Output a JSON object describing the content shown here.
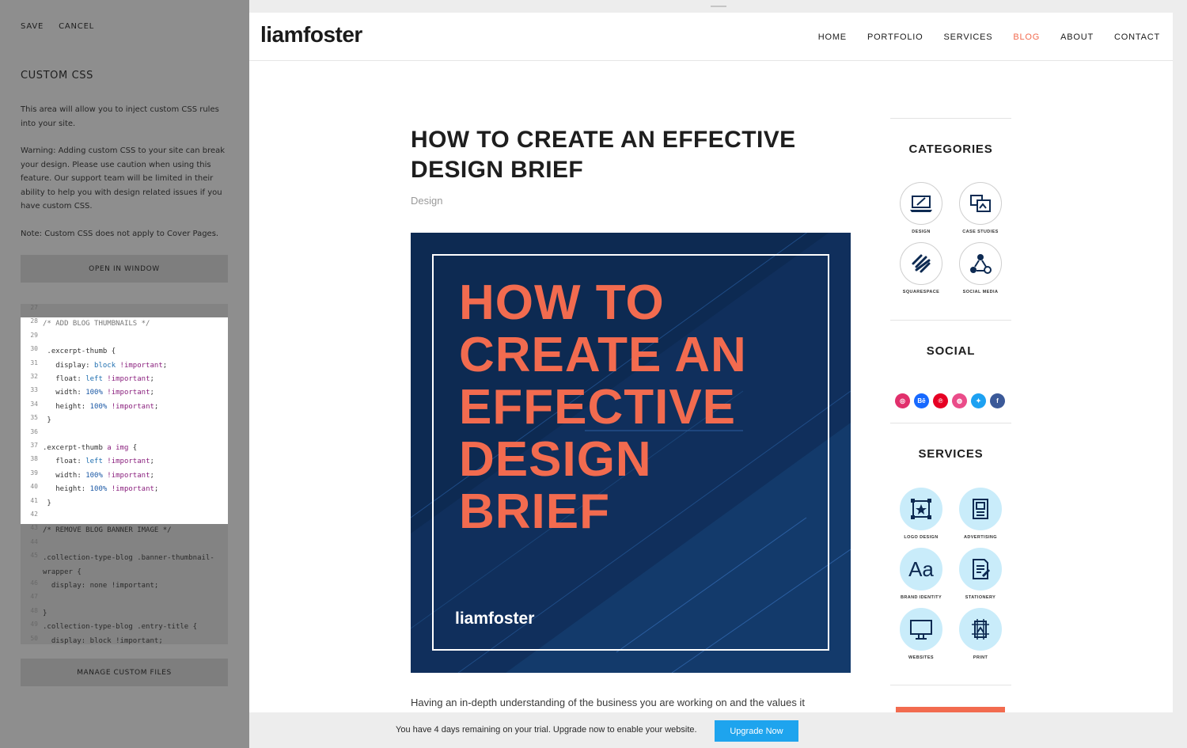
{
  "editor": {
    "save_label": "SAVE",
    "cancel_label": "CANCEL",
    "title": "CUSTOM CSS",
    "intro": "This area will allow you to inject custom CSS rules into your site.",
    "warning": "Warning: Adding custom CSS to your site can break your design. Please use caution when using this feature. Our support team will be limited in their ability to help you with design related issues if you have custom CSS.",
    "note": "Note: Custom CSS does not apply to Cover Pages.",
    "open_window_label": "OPEN IN WINDOW",
    "manage_files_label": "MANAGE CUSTOM FILES",
    "code_lines": [
      {
        "n": "27",
        "text": ""
      },
      {
        "n": "28",
        "text": "/* ADD BLOG THUMBNAILS */"
      },
      {
        "n": "29",
        "text": ""
      },
      {
        "n": "30",
        "text": " .excerpt-thumb {"
      },
      {
        "n": "31",
        "text": "   display: block !important;"
      },
      {
        "n": "32",
        "text": "   float: left !important;"
      },
      {
        "n": "33",
        "text": "   width: 100% !important;"
      },
      {
        "n": "34",
        "text": "   height: 100% !important;"
      },
      {
        "n": "35",
        "text": " }"
      },
      {
        "n": "36",
        "text": ""
      },
      {
        "n": "37",
        "text": ".excerpt-thumb a img {"
      },
      {
        "n": "38",
        "text": "   float: left !important;"
      },
      {
        "n": "39",
        "text": "   width: 100% !important;"
      },
      {
        "n": "40",
        "text": "   height: 100% !important;"
      },
      {
        "n": "41",
        "text": " }"
      },
      {
        "n": "42",
        "text": ""
      },
      {
        "n": "43",
        "text": "/* REMOVE BLOG BANNER IMAGE */"
      },
      {
        "n": "44",
        "text": ""
      },
      {
        "n": "45",
        "text": ".collection-type-blog .banner-thumbnail-"
      },
      {
        "n": "",
        "text": "wrapper {"
      },
      {
        "n": "46",
        "text": "  display: none !important;"
      },
      {
        "n": "47",
        "text": ""
      },
      {
        "n": "48",
        "text": "}"
      },
      {
        "n": "49",
        "text": ".collection-type-blog .entry-title {"
      },
      {
        "n": "50",
        "text": "  display: block !important;"
      }
    ]
  },
  "site": {
    "logo": "liamfoster",
    "nav": [
      "HOME",
      "PORTFOLIO",
      "SERVICES",
      "BLOG",
      "ABOUT",
      "CONTACT"
    ],
    "active_nav": "BLOG",
    "accent_color": "#f26b4f"
  },
  "post": {
    "title": "HOW TO CREATE AN EFFECTIVE DESIGN BRIEF",
    "category": "Design",
    "hero_lines": [
      "HOW TO",
      "CREATE AN",
      "EFFECTIVE",
      "DESIGN",
      "BRIEF"
    ],
    "hero_brand": "liamfoster",
    "excerpt": "Having an in-depth understanding of the business you are working on and the values it"
  },
  "sidebar": {
    "categories_heading": "CATEGORIES",
    "categories": [
      {
        "label": "DESIGN",
        "icon": "laptop-design-icon"
      },
      {
        "label": "CASE STUDIES",
        "icon": "case-studies-icon"
      },
      {
        "label": "SQUARESPACE",
        "icon": "squarespace-icon"
      },
      {
        "label": "SOCIAL MEDIA",
        "icon": "social-network-icon"
      }
    ],
    "social_heading": "SOCIAL",
    "social": [
      {
        "name": "instagram-icon",
        "glyph": "◎",
        "color": "#e1306c"
      },
      {
        "name": "behance-icon",
        "glyph": "Bē",
        "color": "#1769ff"
      },
      {
        "name": "pinterest-icon",
        "glyph": "℗",
        "color": "#e60023"
      },
      {
        "name": "dribbble-icon",
        "glyph": "◍",
        "color": "#ea4c89"
      },
      {
        "name": "twitter-icon",
        "glyph": "✦",
        "color": "#1da1f2"
      },
      {
        "name": "facebook-icon",
        "glyph": "f",
        "color": "#3b5998"
      }
    ],
    "services_heading": "SERVICES",
    "services": [
      {
        "label": "LOGO DESIGN",
        "icon": "logo-design-icon"
      },
      {
        "label": "ADVERTISING",
        "icon": "advertising-icon"
      },
      {
        "label": "BRAND IDENTITY",
        "icon": "brand-identity-icon"
      },
      {
        "label": "STATIONERY",
        "icon": "stationery-icon"
      },
      {
        "label": "WEBSITES",
        "icon": "websites-icon"
      },
      {
        "label": "PRINT",
        "icon": "print-icon"
      }
    ]
  },
  "trial": {
    "message": "You have 4 days remaining on your trial. Upgrade now to enable your website.",
    "button_label": "Upgrade Now",
    "button_color": "#1ea4ee"
  }
}
